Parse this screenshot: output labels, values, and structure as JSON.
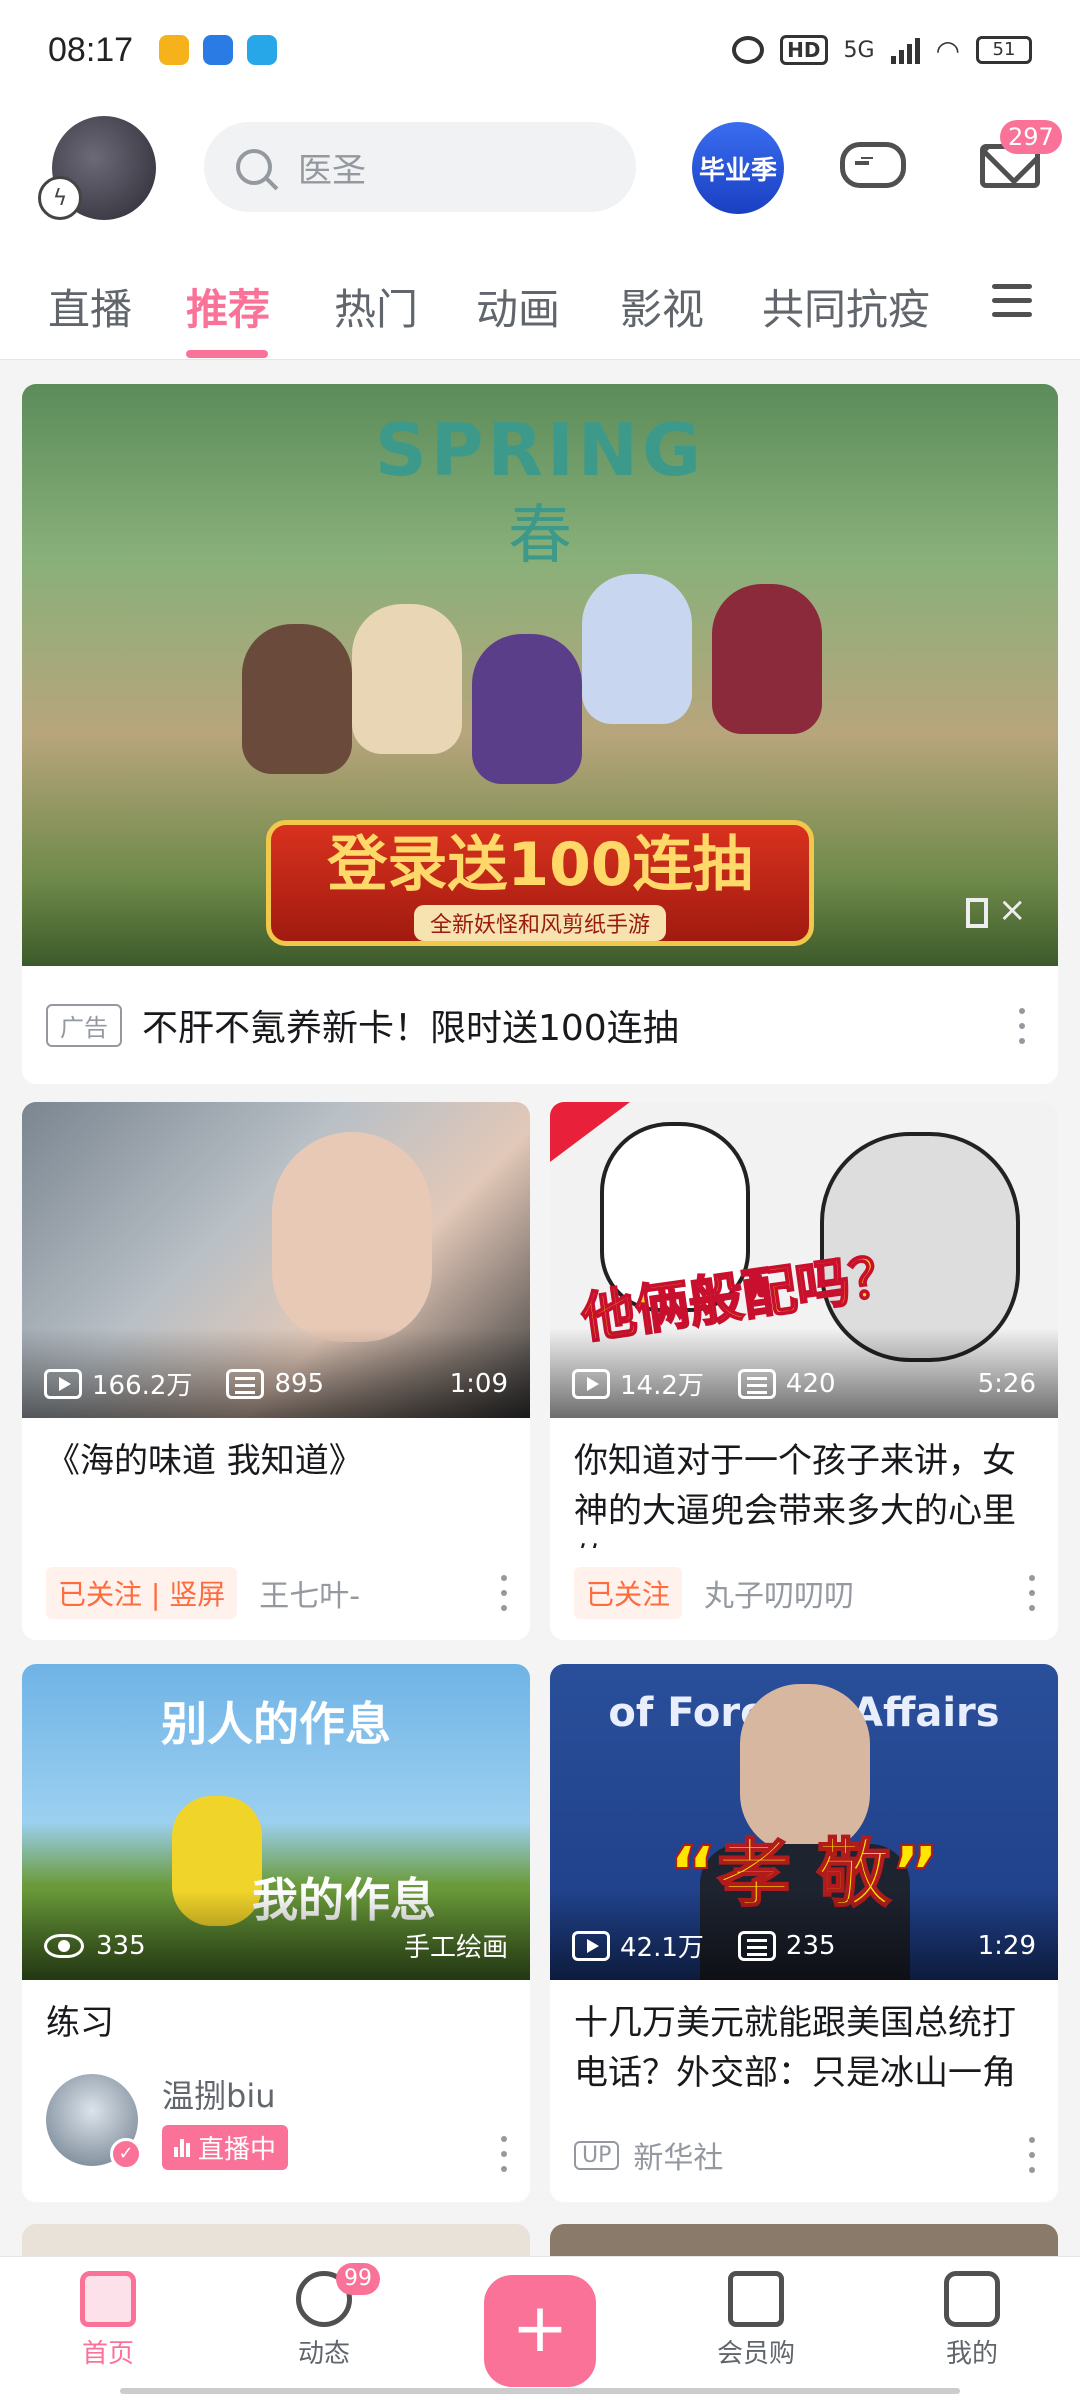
{
  "status_bar": {
    "time": "08:17",
    "hd": "HD",
    "network": "5G",
    "battery": "51"
  },
  "header": {
    "search_placeholder": "医圣",
    "graduation_badge": "毕业季",
    "mail_count": "297"
  },
  "tabs": [
    {
      "label": "直播"
    },
    {
      "label": "推荐"
    },
    {
      "label": "热门"
    },
    {
      "label": "动画"
    },
    {
      "label": "影视"
    },
    {
      "label": "共同抗疫"
    }
  ],
  "banner": {
    "art_title": "SPRING",
    "art_title_cn": "春",
    "promo_title": "登录送100连抽",
    "promo_subtitle": "全新妖怪和风剪纸手游",
    "ad_tag": "广告",
    "title": "不肝不氪养新卡！限时送100连抽"
  },
  "videos": [
    {
      "title": "《海的味道 我知道》",
      "plays": "166.2万",
      "danmaku": "895",
      "duration": "1:09",
      "tag": "已关注 | 竖屏",
      "author": "王七叶-"
    },
    {
      "title": "你知道对于一个孩子来讲，女神的大逼兜会带来多大的心里的…",
      "plays": "14.2万",
      "danmaku": "420",
      "duration": "5:26",
      "thumb_text": "他俩般配吗？",
      "tag": "已关注",
      "author": "丸子叨叨叨"
    },
    {
      "title": "练习",
      "views": "335",
      "category": "手工绘画",
      "thumb_top": "别人的作息",
      "thumb_bottom": "我的作息",
      "author": "温捌biu",
      "live": "直播中"
    },
    {
      "title": "十几万美元就能跟美国总统打电话？外交部：只是冰山一角",
      "plays": "42.1万",
      "danmaku": "235",
      "duration": "1:29",
      "thumb_text": "“孝 敬”",
      "thumb_banner": "of Foreign Affairs",
      "up_tag": "UP",
      "author": "新华社"
    }
  ],
  "bottom_nav": {
    "home": "首页",
    "dynamic": "动态",
    "dynamic_badge": "99",
    "plus": "+",
    "shop": "会员购",
    "mine": "我的"
  },
  "colors": {
    "accent": "#fb7299",
    "follow_tag": "#ff6b3b"
  }
}
